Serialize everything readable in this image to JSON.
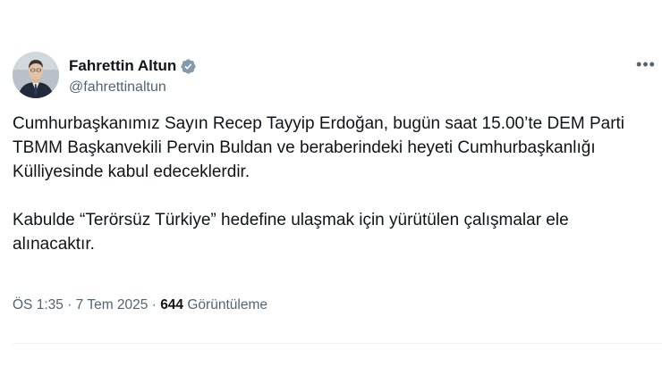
{
  "tweet": {
    "author": {
      "name": "Fahrettin Altun",
      "handle": "@fahrettinaltun",
      "verified": true
    },
    "more_label": "•••",
    "paragraphs": [
      "Cumhurbaşkanımız Sayın Recep Tayyip Erdoğan, bugün saat 15.00’te DEM Parti TBMM Başkanvekili Pervin Buldan ve beraberindeki heyeti Cumhurbaşkanlığı Külliyesinde kabul edeceklerdir.",
      "Kabulde “Terörsüz Türkiye” hedefine ulaşmak için yürütülen çalışmalar ele alınacaktır."
    ],
    "meta": {
      "time": "ÖS 1:35",
      "separator": "·",
      "date": "7 Tem 2025",
      "views_count": "644",
      "views_label": "Görüntüleme"
    }
  },
  "colors": {
    "text_primary": "#0f1419",
    "text_secondary": "#536471",
    "verified_badge": "#829aab",
    "divider": "#eff3f4"
  }
}
